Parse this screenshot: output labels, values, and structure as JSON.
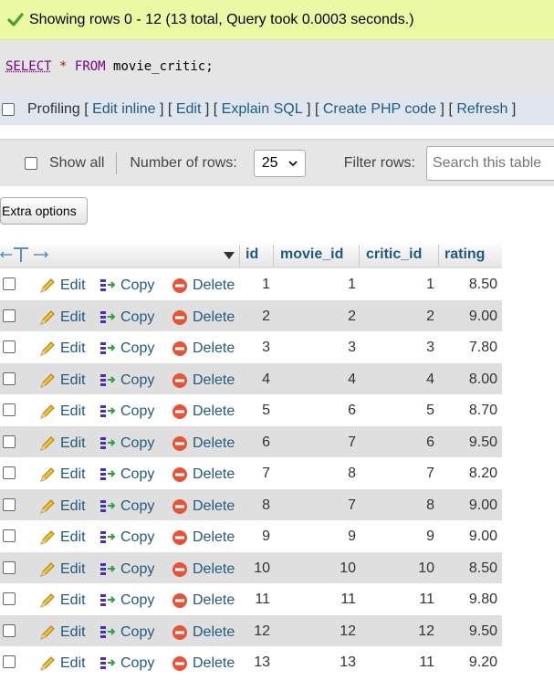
{
  "message": {
    "text": "Showing rows 0 - 12 (13 total, Query took 0.0003 seconds.)"
  },
  "sql": {
    "select": "SELECT",
    "star": "*",
    "from": "FROM",
    "table": "movie_critic;"
  },
  "profiling": {
    "label": "Profiling",
    "links": [
      "Edit inline",
      "Edit",
      "Explain SQL",
      "Create PHP code",
      "Refresh"
    ]
  },
  "nav": {
    "show_all": "Show all",
    "num_rows_label": "Number of rows:",
    "num_rows_value": "25",
    "filter_label": "Filter rows:",
    "search_placeholder": "Search this table"
  },
  "extra_options": "Extra options",
  "table": {
    "headers": [
      "id",
      "movie_id",
      "critic_id",
      "rating"
    ],
    "actions": {
      "edit": "Edit",
      "copy": "Copy",
      "delete": "Delete"
    },
    "rows": [
      [
        "1",
        "1",
        "1",
        "8.50"
      ],
      [
        "2",
        "2",
        "2",
        "9.00"
      ],
      [
        "3",
        "3",
        "3",
        "7.80"
      ],
      [
        "4",
        "4",
        "4",
        "8.00"
      ],
      [
        "5",
        "6",
        "5",
        "8.70"
      ],
      [
        "6",
        "7",
        "6",
        "9.50"
      ],
      [
        "7",
        "8",
        "7",
        "8.20"
      ],
      [
        "8",
        "7",
        "8",
        "9.00"
      ],
      [
        "9",
        "9",
        "9",
        "9.00"
      ],
      [
        "10",
        "10",
        "10",
        "8.50"
      ],
      [
        "11",
        "11",
        "11",
        "9.80"
      ],
      [
        "12",
        "12",
        "12",
        "9.50"
      ],
      [
        "13",
        "13",
        "11",
        "9.20"
      ]
    ]
  },
  "colors": {
    "success_bg": "#ebf8a4",
    "link": "#235a81",
    "row_alt": "#dfdfdf"
  }
}
